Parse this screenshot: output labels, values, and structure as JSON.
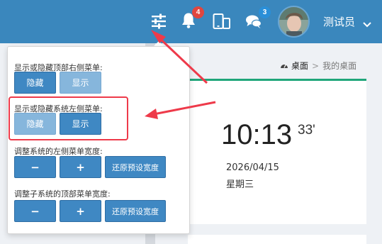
{
  "header": {
    "notification_count": "4",
    "message_count": "3",
    "username": "测试员",
    "icons": [
      "sliders-icon",
      "bell-icon",
      "devices-icon",
      "chat-icon",
      "chevron-down-icon"
    ]
  },
  "breadcrumb": {
    "home": "桌面",
    "separator": ">",
    "current": "我的桌面"
  },
  "clock": {
    "time": "10:13",
    "seconds": "33'",
    "date": "2026/04/15",
    "weekday": "星期三"
  },
  "panel": {
    "top_menu": {
      "label": "显示或隐藏顶部右侧菜单:",
      "hide": "隐藏",
      "show": "显示"
    },
    "left_menu": {
      "label": "显示或隐藏系统左侧菜单:",
      "hide": "隐藏",
      "show": "显示"
    },
    "left_width": {
      "label": "调整系统的左侧菜单宽度:",
      "minus": "−",
      "plus": "+",
      "reset": "还原预设宽度"
    },
    "top_width": {
      "label": "调整子系统的顶部菜单宽度:",
      "minus": "−",
      "plus": "+",
      "reset": "还原预设宽度"
    }
  },
  "colors": {
    "topbar": "#3a87bd",
    "button": "#3f88c3",
    "button_disabled": "#86b6dc",
    "annotation": "#ee3a4a",
    "card_accent": "#1fa67a"
  }
}
